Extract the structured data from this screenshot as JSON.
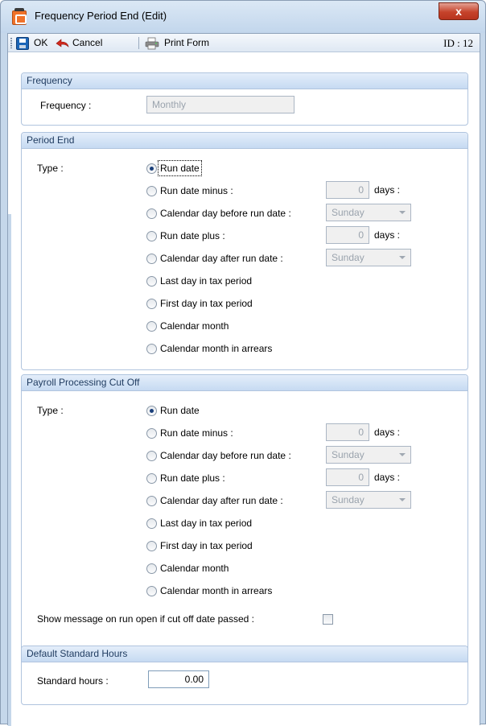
{
  "window": {
    "title": "Frequency Period End (Edit)",
    "close_glyph": "x"
  },
  "toolbar": {
    "ok_label": "OK",
    "cancel_label": "Cancel",
    "print_label": "Print Form",
    "record_id": "ID : 12"
  },
  "frequency": {
    "header": "Frequency",
    "label": "Frequency :",
    "value": "Monthly"
  },
  "period_end": {
    "header": "Period End",
    "type_label": "Type :",
    "options": [
      "Run date",
      "Run date minus :",
      "Calendar day before run date :",
      "Run date plus :",
      "Calendar day after run date :",
      "Last day in tax period",
      "First day in tax period",
      "Calendar month",
      "Calendar month in arrears"
    ],
    "selected": "Run date",
    "minus_days": "0",
    "plus_days": "0",
    "days_label": "days :",
    "before_day": "Sunday",
    "after_day": "Sunday"
  },
  "cut_off": {
    "header": "Payroll Processing Cut Off",
    "type_label": "Type :",
    "options": [
      "Run date",
      "Run date minus :",
      "Calendar day before run date :",
      "Run date plus :",
      "Calendar day after run date :",
      "Last day in tax period",
      "First day in tax period",
      "Calendar month",
      "Calendar month in arrears"
    ],
    "selected": "Run date",
    "minus_days": "0",
    "plus_days": "0",
    "days_label": "days :",
    "before_day": "Sunday",
    "after_day": "Sunday",
    "show_message_label": "Show message on run open if cut off date passed :",
    "show_message_checked": false
  },
  "standard_hours": {
    "header": "Default Standard Hours",
    "label": "Standard hours :",
    "value": "0.00"
  },
  "colors": {
    "group_header": "#c6daf2",
    "window_frame": "#c5d7ea",
    "close_button": "#c6432b"
  }
}
